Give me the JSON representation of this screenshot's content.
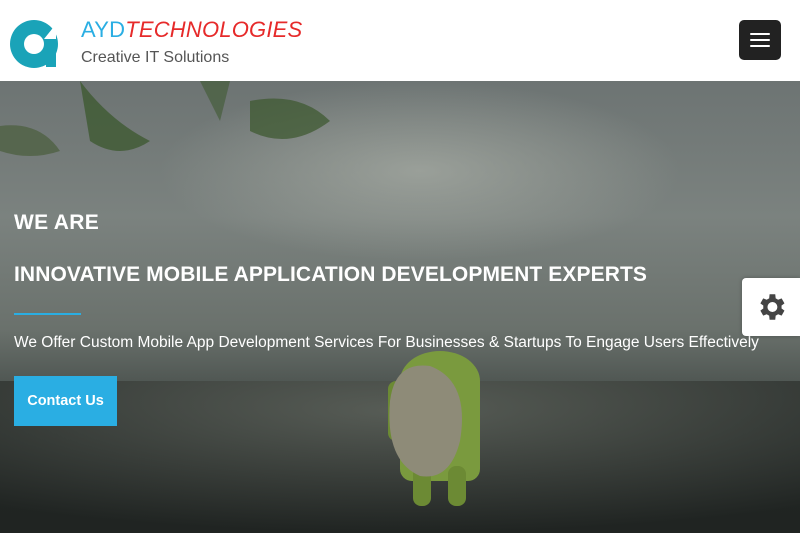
{
  "header": {
    "brand_part1": "AYD",
    "brand_part2": "TECHNOLOGIES",
    "tagline": "Creative IT Solutions",
    "logo_icon": "ayd-logo",
    "menu_icon": "hamburger-icon"
  },
  "hero": {
    "kicker": "WE ARE",
    "headline": "INNOVATIVE MOBILE APPLICATION DEVELOPMENT EXPERTS",
    "subtext": "We Offer Custom Mobile App Development Services For Businesses & Startups To Engage Users Effectively",
    "cta_label": "Contact Us"
  },
  "settings_panel": {
    "icon": "gear-icon"
  },
  "colors": {
    "accent": "#2aaee3",
    "brand_red": "#e62a2a",
    "menu_button": "#222222"
  }
}
